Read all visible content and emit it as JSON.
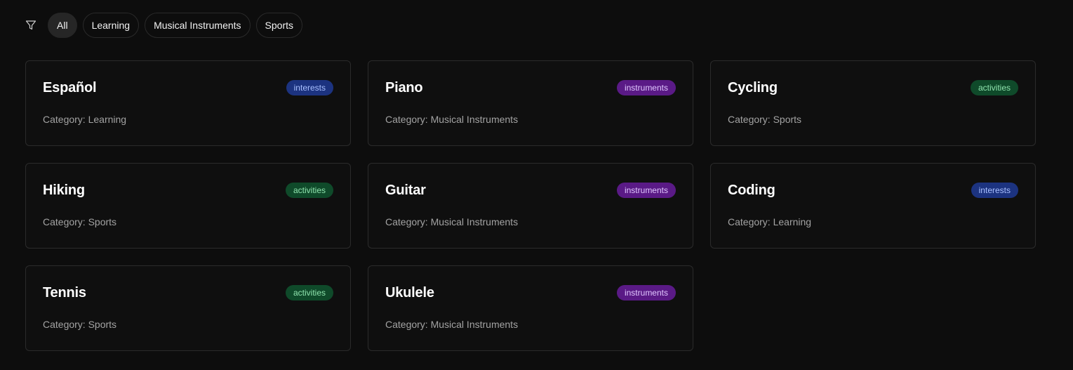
{
  "filters": {
    "icon": "filter-icon",
    "chips": [
      {
        "label": "All",
        "active": true
      },
      {
        "label": "Learning",
        "active": false
      },
      {
        "label": "Musical Instruments",
        "active": false
      },
      {
        "label": "Sports",
        "active": false
      }
    ]
  },
  "colors": {
    "background": "#0d0d0d",
    "interests": "#1c3380",
    "instruments": "#5a1a86",
    "activities": "#0f4a2a"
  },
  "cards": [
    {
      "title": "Español",
      "badge": "interests",
      "category": "Category: Learning"
    },
    {
      "title": "Piano",
      "badge": "instruments",
      "category": "Category: Musical Instruments"
    },
    {
      "title": "Cycling",
      "badge": "activities",
      "category": "Category: Sports"
    },
    {
      "title": "Hiking",
      "badge": "activities",
      "category": "Category: Sports"
    },
    {
      "title": "Guitar",
      "badge": "instruments",
      "category": "Category: Musical Instruments"
    },
    {
      "title": "Coding",
      "badge": "interests",
      "category": "Category: Learning"
    },
    {
      "title": "Tennis",
      "badge": "activities",
      "category": "Category: Sports"
    },
    {
      "title": "Ukulele",
      "badge": "instruments",
      "category": "Category: Musical Instruments"
    }
  ]
}
